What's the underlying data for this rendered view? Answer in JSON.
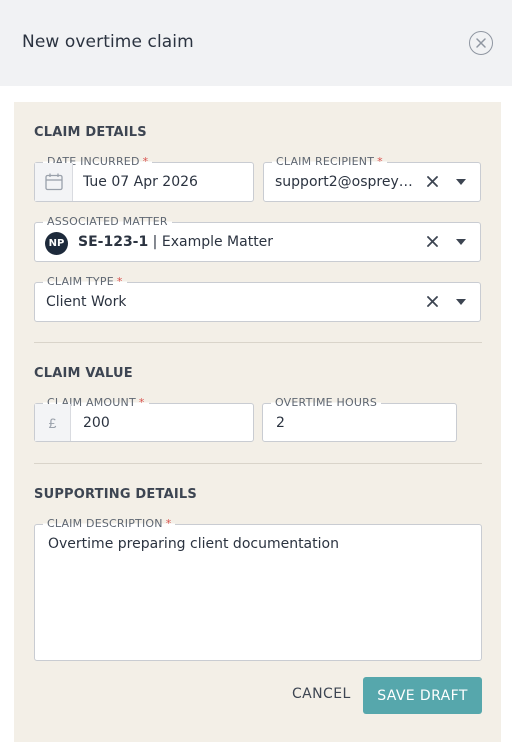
{
  "header": {
    "title": "New overtime claim"
  },
  "sections": {
    "claim_details": "CLAIM DETAILS",
    "claim_value": "CLAIM VALUE",
    "supporting_details": "SUPPORTING DETAILS"
  },
  "fields": {
    "date_incurred": {
      "label": "DATE INCURRED",
      "required": "*",
      "value": "Tue 07 Apr 2026"
    },
    "claim_recipient": {
      "label": "CLAIM RECIPIENT",
      "required": "*",
      "value": "support2@ospreya..."
    },
    "associated_matter": {
      "label": "ASSOCIATED MATTER",
      "avatar": "NP",
      "code": "SE-123-1",
      "separator": " | ",
      "name": "Example Matter"
    },
    "claim_type": {
      "label": "CLAIM TYPE",
      "required": "*",
      "value": "Client Work"
    },
    "claim_amount": {
      "label": "CLAIM AMOUNT",
      "required": "*",
      "prefix": "£",
      "value": "200"
    },
    "overtime_hours": {
      "label": "OVERTIME HOURS",
      "value": "2"
    },
    "claim_description": {
      "label": "CLAIM DESCRIPTION",
      "required": "*",
      "value": "Overtime preparing client documentation"
    }
  },
  "actions": {
    "cancel": "CANCEL",
    "save_draft": "SAVE DRAFT"
  },
  "colors": {
    "panel_bg": "#f3efe7",
    "primary_button": "#56a7ac",
    "required_marker": "#d9534f",
    "avatar_bg": "#1d2a3b"
  },
  "icons": {
    "close": "close-circle-icon",
    "calendar": "calendar-icon",
    "clear": "clear-x-icon",
    "dropdown": "chevron-down-icon"
  }
}
